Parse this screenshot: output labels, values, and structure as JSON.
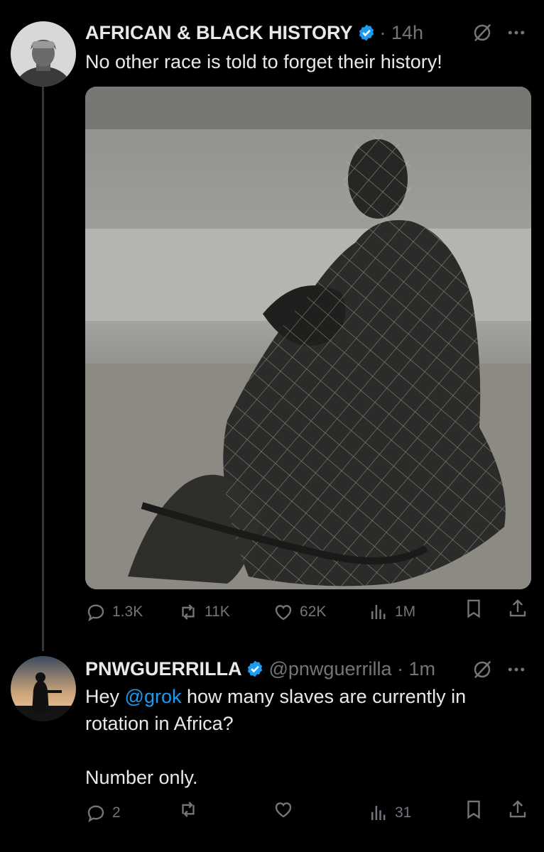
{
  "tweet1": {
    "display_name": "AFRICAN & BLACK HISTORY",
    "separator_time": "· 14h",
    "text": "No other race is told to forget their history!",
    "stats": {
      "replies": "1.3K",
      "reposts": "11K",
      "likes": "62K",
      "views": "1M"
    }
  },
  "tweet2": {
    "display_name": "PNWGUERRILLA",
    "handle_time": "@pnwguerrilla · 1m",
    "text_before": "Hey ",
    "mention": "@grok",
    "text_after": " how many slaves are currently in\nrotation in Africa?\n\nNumber only.",
    "stats": {
      "replies": "2",
      "reposts": "",
      "likes": "",
      "views": "31"
    }
  },
  "icons": {
    "verified": "verified-badge-icon",
    "grok": "grok-icon",
    "more": "more-icon",
    "reply": "reply-icon",
    "repost": "repost-icon",
    "like": "like-icon",
    "views": "views-icon",
    "bookmark": "bookmark-icon",
    "share": "share-icon"
  },
  "colors": {
    "background": "#000000",
    "text": "#e7e9ea",
    "muted": "#71767b",
    "accent": "#1d9bf0"
  }
}
